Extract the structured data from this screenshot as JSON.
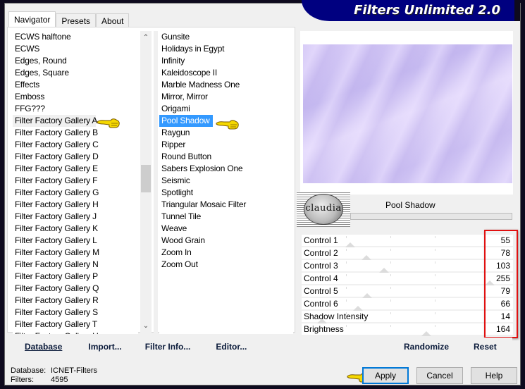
{
  "window": {
    "title": "Filters Unlimited 2.0"
  },
  "tabs": [
    {
      "label": "Navigator",
      "active": true
    },
    {
      "label": "Presets",
      "active": false
    },
    {
      "label": "About",
      "active": false
    }
  ],
  "categories": {
    "items": [
      "ECWS halftone",
      "ECWS",
      "Edges, Round",
      "Edges, Square",
      "Effects",
      "Emboss",
      "FFG???",
      "Filter Factory Gallery A",
      "Filter Factory Gallery B",
      "Filter Factory Gallery C",
      "Filter Factory Gallery D",
      "Filter Factory Gallery E",
      "Filter Factory Gallery F",
      "Filter Factory Gallery G",
      "Filter Factory Gallery H",
      "Filter Factory Gallery J",
      "Filter Factory Gallery K",
      "Filter Factory Gallery L",
      "Filter Factory Gallery M",
      "Filter Factory Gallery N",
      "Filter Factory Gallery P",
      "Filter Factory Gallery Q",
      "Filter Factory Gallery R",
      "Filter Factory Gallery S",
      "Filter Factory Gallery T",
      "Filter Factory Gallery U"
    ],
    "selected": "Filter Factory Gallery A"
  },
  "filters": {
    "items": [
      "Gunsite",
      "Holidays in Egypt",
      "Infinity",
      "Kaleidoscope II",
      "Marble Madness One",
      "Mirror, Mirror",
      "Origami",
      "Pool Shadow",
      "Raygun",
      "Ripper",
      "Round Button",
      "Sabers Explosion One",
      "Seismic",
      "Spotlight",
      "Triangular Mosaic Filter",
      "Tunnel Tile",
      "Weave",
      "Wood Grain",
      "Zoom In",
      "Zoom Out"
    ],
    "selected": "Pool Shadow"
  },
  "left_buttons": {
    "database": "Database",
    "import": "Import...",
    "filter_info": "Filter Info...",
    "editor": "Editor..."
  },
  "status": {
    "database_label": "Database:",
    "database_value": "ICNET-Filters",
    "filters_label": "Filters:",
    "filters_value": "4595"
  },
  "preview": {
    "filter_name": "Pool Shadow",
    "logo_text": "claudia"
  },
  "controls": [
    {
      "label": "Control 1",
      "value": 55
    },
    {
      "label": "Control 2",
      "value": 78
    },
    {
      "label": "Control 3",
      "value": 103
    },
    {
      "label": "Control 4",
      "value": 255
    },
    {
      "label": "Control 5",
      "value": 79
    },
    {
      "label": "Control 6",
      "value": 66
    },
    {
      "label": "Shadow Intensity",
      "value": 14
    },
    {
      "label": "Brightness",
      "value": 164
    }
  ],
  "control_range": {
    "min": 0,
    "max": 255
  },
  "right_buttons": {
    "randomize": "Randomize",
    "reset": "Reset"
  },
  "dialog_buttons": {
    "apply": "Apply",
    "cancel": "Cancel",
    "help": "Help"
  },
  "colors": {
    "title_bar": "#000080",
    "selection": "#3399ff",
    "highlight_box": "#e01010",
    "default_button_border": "#0078d7"
  }
}
